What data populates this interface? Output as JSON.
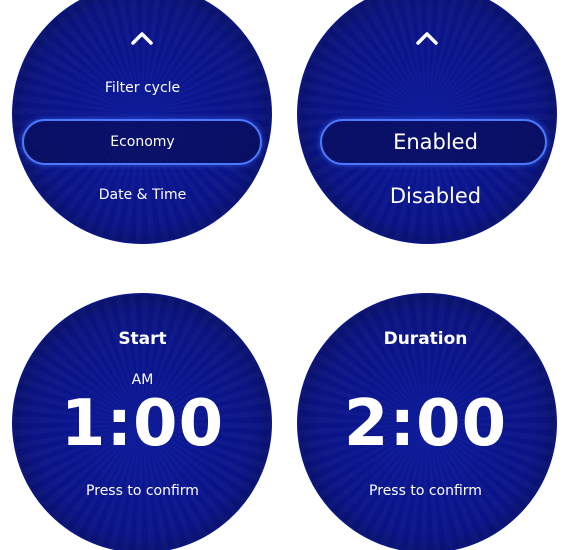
{
  "menu_screen": {
    "items": [
      "Filter cycle",
      "Economy",
      "Date & Time"
    ],
    "selected": "Economy",
    "up_icon": "chevron-up-icon",
    "down_icon": "chevron-down-icon"
  },
  "economy_screen": {
    "options": [
      "Enabled",
      "Disabled"
    ],
    "selected": "Enabled",
    "up_icon": "chevron-up-icon",
    "down_icon": "chevron-down-icon"
  },
  "start_screen": {
    "title": "Start",
    "period": "AM",
    "time": "1:00",
    "hint": "Press to confirm"
  },
  "duration_screen": {
    "title": "Duration",
    "time": "2:00",
    "hint": "Press to confirm"
  },
  "colors": {
    "dial_blue": "#0a148a",
    "ring_highlight": "#4a78ff",
    "text": "#ffffff",
    "background": "#ffffff"
  }
}
